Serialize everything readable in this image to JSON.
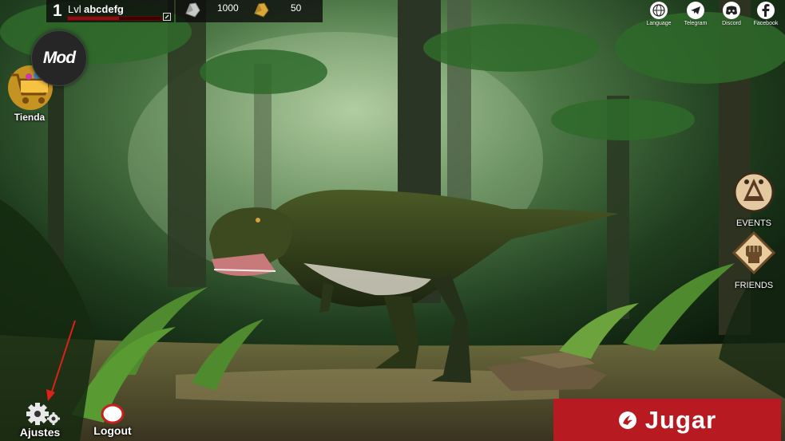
{
  "player": {
    "level": "1",
    "level_prefix": "Lvl",
    "name": "abcdefg",
    "xp_progress": 0.55
  },
  "resources": [
    {
      "icon": "silver-ore-icon",
      "value": "1000"
    },
    {
      "icon": "gold-ore-icon",
      "value": "50"
    }
  ],
  "social": [
    {
      "icon": "globe-icon",
      "label": "Language"
    },
    {
      "icon": "telegram-icon",
      "label": "Telegram"
    },
    {
      "icon": "discord-icon",
      "label": "Discord"
    },
    {
      "icon": "facebook-icon",
      "label": "Facebook"
    }
  ],
  "mod_badge": "Mod",
  "shop": {
    "icon": "shopping-cart-icon",
    "label": "Tienda"
  },
  "events": {
    "icon": "events-emblem-icon",
    "label": "EVENTS"
  },
  "friends": {
    "icon": "fist-emblem-icon",
    "label": "FRIENDS"
  },
  "settings": {
    "icon": "gear-icon",
    "label": "Ajustes"
  },
  "logout": {
    "icon": "logout-icon",
    "label": "Logout"
  },
  "play": {
    "icon": "dino-claw-icon",
    "label": "Jugar"
  },
  "colors": {
    "play_button": "#b81a22",
    "topbar": "#0a0a0a",
    "xp_fill": "#8a1010",
    "annotation_arrow": "#e0201a"
  }
}
